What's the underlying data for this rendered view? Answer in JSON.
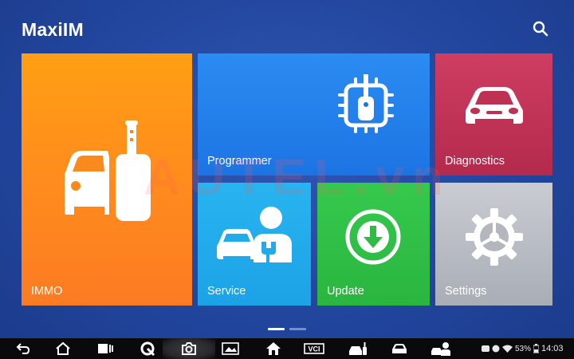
{
  "app": {
    "title": "MaxiIM"
  },
  "watermark": "AUTEL.vn",
  "tiles": {
    "immo": {
      "label": "IMMO"
    },
    "programmer": {
      "label": "Programmer"
    },
    "diagnostics": {
      "label": "Diagnostics"
    },
    "service": {
      "label": "Service"
    },
    "update": {
      "label": "Update"
    },
    "settings": {
      "label": "Settings"
    }
  },
  "pagination": {
    "pages": 2,
    "current": 1
  },
  "navbar": {
    "buttons": [
      "back-icon",
      "home-icon",
      "recent-apps-icon",
      "browser-icon",
      "camera-icon",
      "screenshot-icon",
      "home-shortcut-icon",
      "vci-icon",
      "immo-shortcut-icon",
      "car-icon",
      "service-shortcut-icon"
    ],
    "vci_label": "VCI"
  },
  "status": {
    "battery": "53%",
    "time": "14:03"
  },
  "colors": {
    "background": "#22469e",
    "immo": "#ff9112",
    "programmer": "#1c7ce8",
    "diagnostics": "#c13557",
    "service": "#22abeb",
    "update": "#31c048",
    "settings": "#bcc0c6"
  }
}
